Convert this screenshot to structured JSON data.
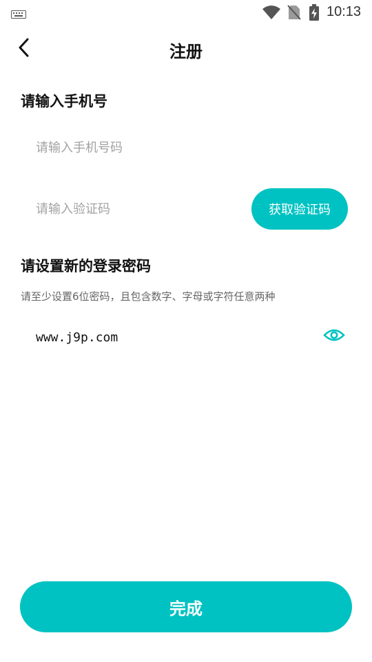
{
  "status_bar": {
    "time": "10:13",
    "icons": [
      "keyboard-icon",
      "wifi-icon",
      "no-sim-icon",
      "battery-charging-icon"
    ]
  },
  "header": {
    "back_icon": "chevron-left-icon",
    "title": "注册"
  },
  "phone_section": {
    "title": "请输入手机号",
    "phone_placeholder": "请输入手机号码",
    "code_placeholder": "请输入验证码",
    "get_code_label": "获取验证码"
  },
  "password_section": {
    "title": "请设置新的登录密码",
    "hint": "请至少设置6位密码，且包含数字、字母或字符任意两种",
    "password_value": "www.j9p.com",
    "visibility_icon": "eye-icon"
  },
  "submit": {
    "label": "完成"
  },
  "colors": {
    "accent": "#00c2c2",
    "placeholder": "#a2a2a2",
    "hint": "#666666"
  }
}
